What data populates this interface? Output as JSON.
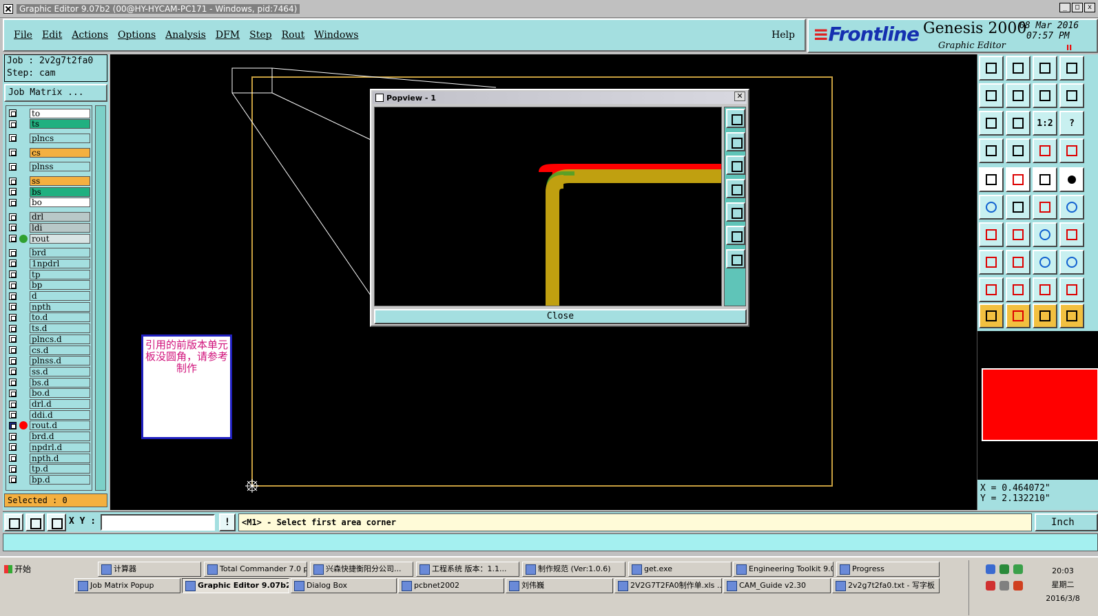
{
  "window": {
    "title": "Graphic Editor 9.07b2 (00@HY-HYCAM-PC171 - Windows, pid:7464)",
    "controls": [
      "_",
      "□",
      "x"
    ]
  },
  "menu": {
    "items": [
      "File",
      "Edit",
      "Actions",
      "Options",
      "Analysis",
      "DFM",
      "Step",
      "Rout",
      "Windows"
    ],
    "help": "Help"
  },
  "logo": {
    "brand": "Frontline",
    "product": "Genesis 2000",
    "subtitle": "Graphic Editor",
    "date": "08 Mar 2016",
    "time": "07:57 PM",
    "pause": "II"
  },
  "job": {
    "job_line": "Job : 2v2g7t2fa0",
    "step_line": "Step: cam",
    "matrix_button": "Job Matrix ...",
    "selected": "Selected : 0"
  },
  "layers": [
    {
      "name": "to",
      "color": "#ffffff"
    },
    {
      "name": "ts",
      "color": "#20b080"
    },
    {
      "name": "plncs",
      "color": "#a4dfe0"
    },
    {
      "name": "cs",
      "color": "#f4b040"
    },
    {
      "name": "plnss",
      "color": "#a4dfe0"
    },
    {
      "name": "ss",
      "color": "#f4b040"
    },
    {
      "name": "bs",
      "color": "#20b080"
    },
    {
      "name": "bo",
      "color": "#ffffff"
    },
    {
      "name": "drl",
      "color": "#b8c8c8"
    },
    {
      "name": "ldi",
      "color": "#b8c8c8"
    },
    {
      "name": "rout",
      "color": "#d8e4e4",
      "marker": "#30a030"
    },
    {
      "name": "brd",
      "color": "#a4dfe0"
    },
    {
      "name": "1npdrl",
      "color": "#a4dfe0"
    },
    {
      "name": "tp",
      "color": "#a4dfe0"
    },
    {
      "name": "bp",
      "color": "#a4dfe0"
    },
    {
      "name": "d",
      "color": "#a4dfe0"
    },
    {
      "name": "npth",
      "color": "#a4dfe0"
    },
    {
      "name": "to.d",
      "color": "#a4dfe0"
    },
    {
      "name": "ts.d",
      "color": "#a4dfe0"
    },
    {
      "name": "plncs.d",
      "color": "#a4dfe0"
    },
    {
      "name": "cs.d",
      "color": "#a4dfe0"
    },
    {
      "name": "plnss.d",
      "color": "#a4dfe0"
    },
    {
      "name": "ss.d",
      "color": "#a4dfe0"
    },
    {
      "name": "bs.d",
      "color": "#a4dfe0"
    },
    {
      "name": "bo.d",
      "color": "#a4dfe0"
    },
    {
      "name": "drl.d",
      "color": "#a4dfe0"
    },
    {
      "name": "ddi.d",
      "color": "#a4dfe0"
    },
    {
      "name": "rout.d",
      "color": "#a4dfe0",
      "marker": "#ff0000",
      "selected": true
    },
    {
      "name": "brd.d",
      "color": "#a4dfe0"
    },
    {
      "name": "npdrl.d",
      "color": "#a4dfe0"
    },
    {
      "name": "npth.d",
      "color": "#a4dfe0"
    },
    {
      "name": "tp.d",
      "color": "#a4dfe0"
    },
    {
      "name": "bp.d",
      "color": "#a4dfe0"
    }
  ],
  "note": {
    "text": "引用的前版本单元板没圆角，请参考制作"
  },
  "popview": {
    "title": "Popview - 1",
    "close_label": "Close",
    "tools": [
      "zoom-home-icon",
      "zoom-top-icon",
      "zoom-bottom-icon",
      "zoom-left-icon",
      "zoom-right-icon",
      "zoom-fit-icon",
      "zoom-center-icon"
    ]
  },
  "right_tools": {
    "ratio_label": "1:2",
    "help_label": "?"
  },
  "coords": {
    "x": "X = 0.464072\"",
    "y": "Y = 2.132210\""
  },
  "command": {
    "xy_label": "X Y :",
    "xy_value": "",
    "bang": "!",
    "prompt": "<M1> - Select first area corner",
    "units": "Inch"
  },
  "taskbar": {
    "start": "开始",
    "row1": [
      "计算器",
      "Total Commander 7.0 p...",
      "兴森快捷衡阳分公司...",
      "工程系统  版本：1.1...",
      "制作规范 (Ver:1.0.6)",
      "get.exe",
      "Engineering Toolkit 9.0...",
      "Progress"
    ],
    "row2": [
      "Job Matrix Popup",
      "Graphic Editor 9.07b2...",
      "Dialog Box",
      "pcbnet2002",
      "刘伟巍",
      "2V2G7T2FA0制作单.xls ...",
      "CAM_Guide v2.30",
      "2v2g7t2fa0.txt - 写字板"
    ],
    "clock_time": "20:03",
    "clock_day": "星期二",
    "clock_date": "2016/3/8"
  }
}
